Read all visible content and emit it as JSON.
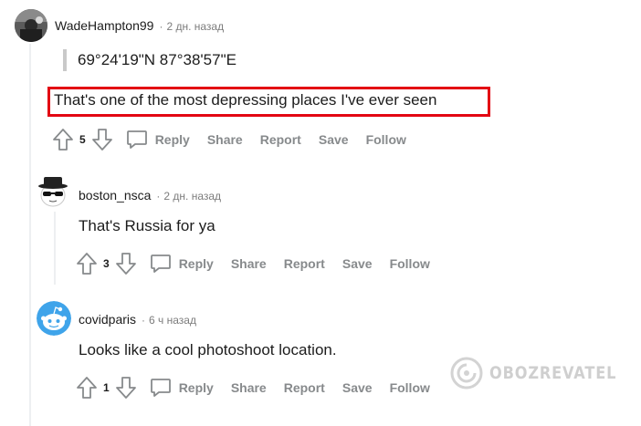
{
  "comments": [
    {
      "author": "WadeHampton99",
      "separator": "·",
      "time": "2 дн. назад",
      "quote": "69°24'19\"N 87°38'57\"E",
      "text": "That's one of the most depressing places I've ever seen",
      "votes": "5"
    },
    {
      "author": "boston_nsca",
      "separator": "·",
      "time": "2 дн. назад",
      "text": "That's Russia for ya",
      "votes": "3"
    },
    {
      "author": "covidparis",
      "separator": "·",
      "time": "6 ч назад",
      "text": "Looks like a cool photoshoot location.",
      "votes": "1"
    }
  ],
  "actions": {
    "reply": "Reply",
    "share": "Share",
    "report": "Report",
    "save": "Save",
    "follow": "Follow"
  },
  "watermark": "OBOZREVATEL",
  "colors": {
    "highlight": "#e30613",
    "meta": "#7c7c7c",
    "action": "#878a8c",
    "thread_line": "#edeff1",
    "snoo_blue": "#3fa4ea"
  },
  "icons": [
    "upvote-icon",
    "downvote-icon",
    "comment-bubble-icon"
  ]
}
